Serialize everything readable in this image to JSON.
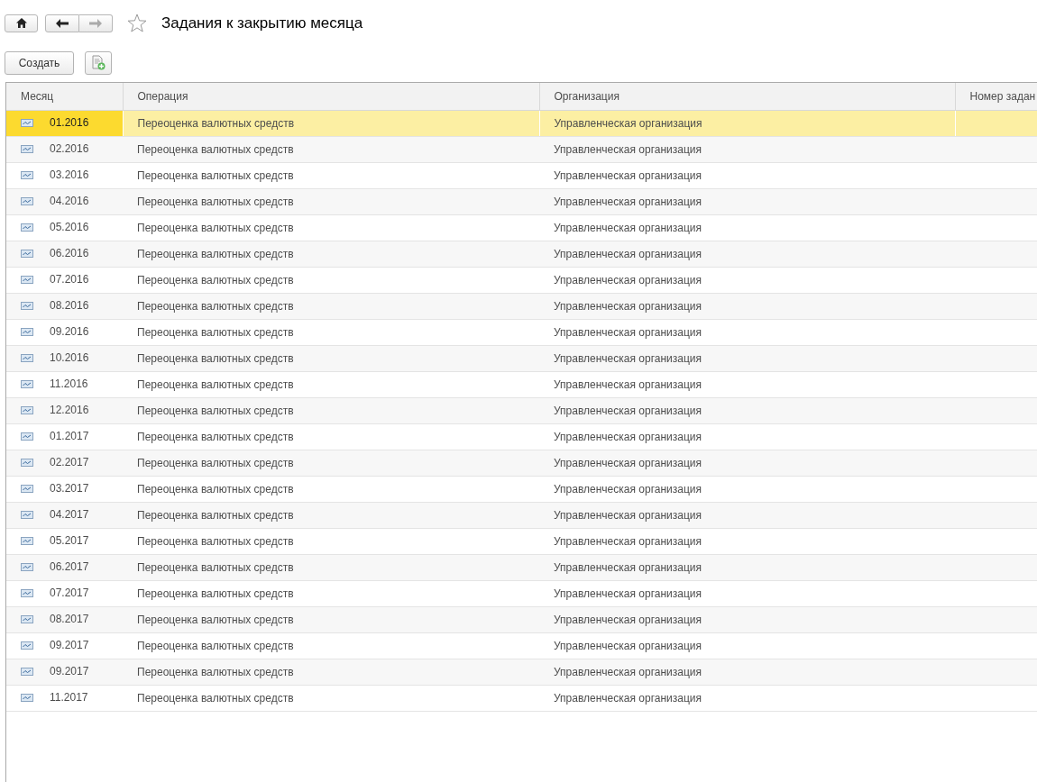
{
  "window": {
    "title": "Задания к закрытию месяца",
    "favorite": false
  },
  "toolbar": {
    "create_button": "Создать"
  },
  "table": {
    "columns": [
      "Месяц",
      "Операция",
      "Организация",
      "Номер задан"
    ],
    "rows": [
      {
        "month": "01.2016",
        "operation": "Переоценка валютных средств",
        "organization": "Управленческая организация",
        "selected": true
      },
      {
        "month": "02.2016",
        "operation": "Переоценка валютных средств",
        "organization": "Управленческая организация",
        "selected": false
      },
      {
        "month": "03.2016",
        "operation": "Переоценка валютных средств",
        "organization": "Управленческая организация",
        "selected": false
      },
      {
        "month": "04.2016",
        "operation": "Переоценка валютных средств",
        "organization": "Управленческая организация",
        "selected": false
      },
      {
        "month": "05.2016",
        "operation": "Переоценка валютных средств",
        "organization": "Управленческая организация",
        "selected": false
      },
      {
        "month": "06.2016",
        "operation": "Переоценка валютных средств",
        "organization": "Управленческая организация",
        "selected": false
      },
      {
        "month": "07.2016",
        "operation": "Переоценка валютных средств",
        "organization": "Управленческая организация",
        "selected": false
      },
      {
        "month": "08.2016",
        "operation": "Переоценка валютных средств",
        "organization": "Управленческая организация",
        "selected": false
      },
      {
        "month": "09.2016",
        "operation": "Переоценка валютных средств",
        "organization": "Управленческая организация",
        "selected": false
      },
      {
        "month": "10.2016",
        "operation": "Переоценка валютных средств",
        "organization": "Управленческая организация",
        "selected": false
      },
      {
        "month": "11.2016",
        "operation": "Переоценка валютных средств",
        "organization": "Управленческая организация",
        "selected": false
      },
      {
        "month": "12.2016",
        "operation": "Переоценка валютных средств",
        "organization": "Управленческая организация",
        "selected": false
      },
      {
        "month": "01.2017",
        "operation": "Переоценка валютных средств",
        "organization": "Управленческая организация",
        "selected": false
      },
      {
        "month": "02.2017",
        "operation": "Переоценка валютных средств",
        "organization": "Управленческая организация",
        "selected": false
      },
      {
        "month": "03.2017",
        "operation": "Переоценка валютных средств",
        "organization": "Управленческая организация",
        "selected": false
      },
      {
        "month": "04.2017",
        "operation": "Переоценка валютных средств",
        "organization": "Управленческая организация",
        "selected": false
      },
      {
        "month": "05.2017",
        "operation": "Переоценка валютных средств",
        "organization": "Управленческая организация",
        "selected": false
      },
      {
        "month": "06.2017",
        "operation": "Переоценка валютных средств",
        "organization": "Управленческая организация",
        "selected": false
      },
      {
        "month": "07.2017",
        "operation": "Переоценка валютных средств",
        "organization": "Управленческая организация",
        "selected": false
      },
      {
        "month": "08.2017",
        "operation": "Переоценка валютных средств",
        "organization": "Управленческая организация",
        "selected": false
      },
      {
        "month": "09.2017",
        "operation": "Переоценка валютных средств",
        "organization": "Управленческая организация",
        "selected": false
      },
      {
        "month": "09.2017",
        "operation": "Переоценка валютных средств",
        "organization": "Управленческая организация",
        "selected": false
      },
      {
        "month": "11.2017",
        "operation": "Переоценка валютных средств",
        "organization": "Управленческая организация",
        "selected": false
      }
    ]
  }
}
